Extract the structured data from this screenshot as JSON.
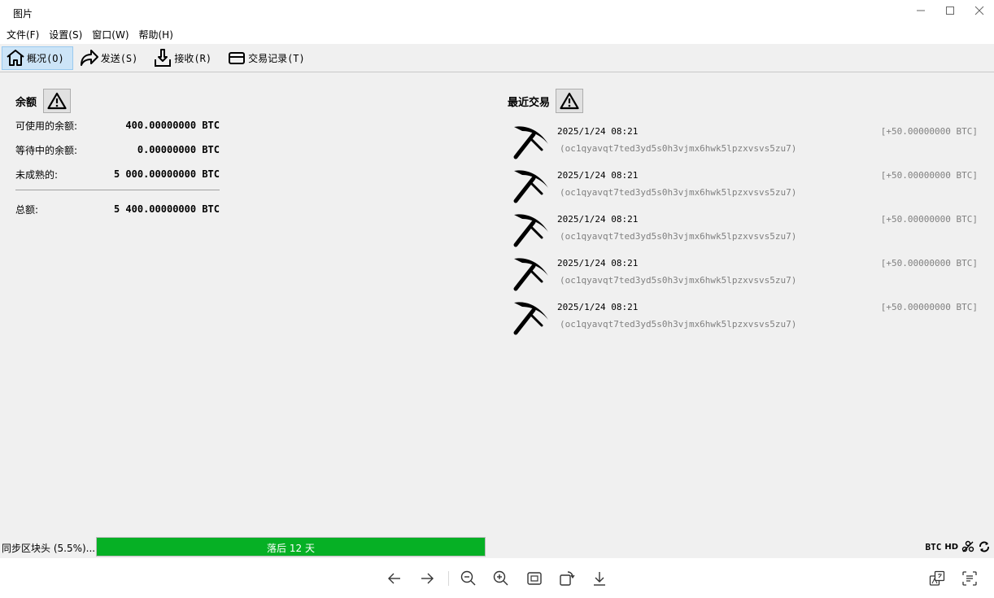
{
  "window": {
    "title": "图片"
  },
  "menu": {
    "items": [
      {
        "label": "文件(F)"
      },
      {
        "label": "设置(S)"
      },
      {
        "label": "窗口(W)"
      },
      {
        "label": "帮助(H)"
      }
    ]
  },
  "toolbar": {
    "tabs": [
      {
        "label": "概况(O)",
        "icon": "home-icon",
        "active": true
      },
      {
        "label": "发送(S)",
        "icon": "send-icon"
      },
      {
        "label": "接收(R)",
        "icon": "receive-icon"
      },
      {
        "label": "交易记录(T)",
        "icon": "transactions-icon"
      }
    ]
  },
  "balances": {
    "title": "余额",
    "available_label": "可使用的余额:",
    "available_value": "400.00000000 BTC",
    "pending_label": "等待中的余额:",
    "pending_value": "0.00000000 BTC",
    "immature_label": "未成熟的:",
    "immature_value": "5 000.00000000 BTC",
    "total_label": "总额:",
    "total_value": "5 400.00000000 BTC"
  },
  "recent": {
    "title": "最近交易",
    "transactions": [
      {
        "date": "2025/1/24 08:21",
        "amount": "[+50.00000000 BTC]",
        "address": "(oc1qyavqt7ted3yd5s0h3vjmx6hwk5lpzxvsvs5zu7)",
        "icon": "pickaxe-icon"
      },
      {
        "date": "2025/1/24 08:21",
        "amount": "[+50.00000000 BTC]",
        "address": "(oc1qyavqt7ted3yd5s0h3vjmx6hwk5lpzxvsvs5zu7)",
        "icon": "pickaxe-icon"
      },
      {
        "date": "2025/1/24 08:21",
        "amount": "[+50.00000000 BTC]",
        "address": "(oc1qyavqt7ted3yd5s0h3vjmx6hwk5lpzxvsvs5zu7)",
        "icon": "pickaxe-icon"
      },
      {
        "date": "2025/1/24 08:21",
        "amount": "[+50.00000000 BTC]",
        "address": "(oc1qyavqt7ted3yd5s0h3vjmx6hwk5lpzxvsvs5zu7)",
        "icon": "pickaxe-icon"
      },
      {
        "date": "2025/1/24 08:21",
        "amount": "[+50.00000000 BTC]",
        "address": "(oc1qyavqt7ted3yd5s0h3vjmx6hwk5lpzxvsvs5zu7)",
        "icon": "pickaxe-icon"
      }
    ]
  },
  "status": {
    "sync_label": "同步区块头 (5.5%)...",
    "progress_text": "落后 12 天",
    "progress_fraction": 1.0,
    "progress_color": "#06b025",
    "unit": "BTC",
    "hd": "HD"
  },
  "colors": {
    "active_tab_bg": "#cce4f7",
    "muted_text": "#808080"
  }
}
